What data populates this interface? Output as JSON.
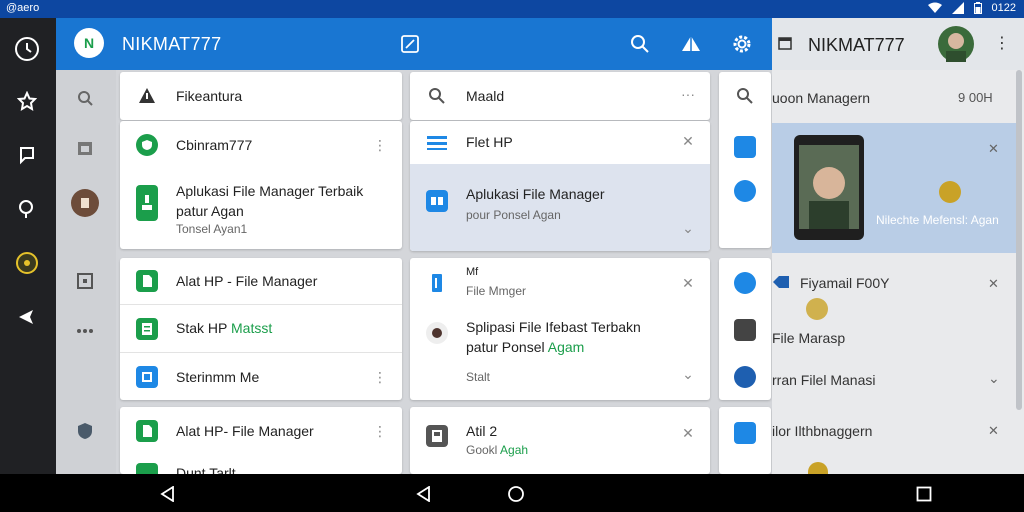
{
  "status_bar": {
    "left_text": "@aero",
    "time": "0122"
  },
  "app_bar": {
    "logo_text": "N",
    "title": "NIKMAT777"
  },
  "list_col": {
    "search_row": {
      "label": "Fikeantura"
    },
    "card1": {
      "row1": "Cbinram777",
      "row2_line1": "Aplukasi File Manager Terbaik",
      "row2_line2": "patur Agan",
      "row2_line3": "Tonsel Ayan1"
    },
    "card2": {
      "row1": "Alat HP - File Manager",
      "row2_a": "Stak HP",
      "row2_b": "Matsst",
      "row3": "Sterinmm Me"
    },
    "card3": {
      "row1": "Alat HP- File Manager",
      "row2": "Dunt Tarlt"
    }
  },
  "mid_col": {
    "search_row": {
      "label": "Maald"
    },
    "header_row": {
      "label": "Flet HP"
    },
    "selected": {
      "line1": "Aplukasi File Manager",
      "line2": "pour Ponsel Agan"
    },
    "card2": {
      "line1": "Mf",
      "line2": "File Mmger",
      "row2_line1": "Splipasi File Ifebast Terbakn",
      "row2_line2_a": "patur Ponsel",
      "row2_line2_b": "Agam",
      "row3": "Stalt"
    },
    "card3": {
      "line1": "Atil 2",
      "line2_a": "Gookl",
      "line2_b": "Agah"
    }
  },
  "right_panel": {
    "title": "NIKMAT777",
    "row1": {
      "label": "uoon Managern",
      "value": "9 00H"
    },
    "image_caption": "Nilechte Mefensl: Agan",
    "row3": {
      "label": "Fiyamail F00Y"
    },
    "row4": {
      "label": "File Marasp"
    },
    "row5": {
      "label": "rran Filel Manasi"
    },
    "row6": {
      "label": "ilor Ilthbnaggern"
    }
  },
  "colors": {
    "app_bar": "#1976d2",
    "status_bar": "#0d47a1",
    "accent_green": "#1b9e4b",
    "accent_blue": "#1e88e5"
  }
}
